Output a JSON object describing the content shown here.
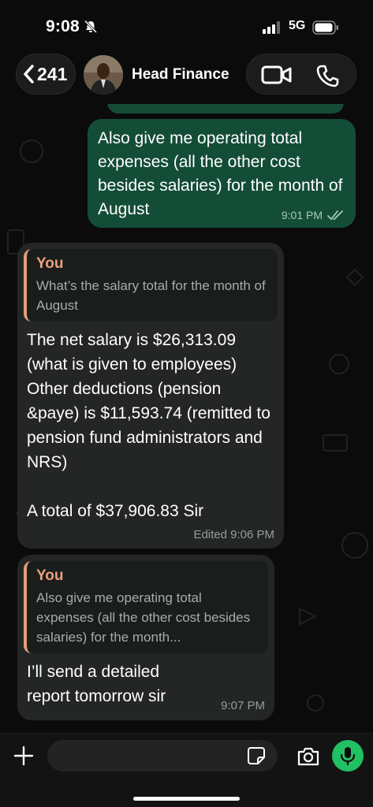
{
  "status_bar": {
    "time": "9:08",
    "network": "5G"
  },
  "header": {
    "back_count": "241",
    "contact_name": "Head Finance",
    "icons": [
      "chevron-left-icon",
      "video-call-icon",
      "phone-call-icon"
    ]
  },
  "messages": [
    {
      "direction": "sent",
      "text": "Also give me operating total expenses (all the other cost besides salaries) for the month of August",
      "time": "9:01 PM",
      "status": "read"
    },
    {
      "direction": "received",
      "quote_author": "You",
      "quote_text": "What’s the salary total for the month of August",
      "text": "The net salary is $26,313.09 (what is given to employees) Other deductions (pension &paye) is $11,593.74 (remitted to pension fund administrators and NRS)\n\nA total of $37,906.83 Sir",
      "time": "Edited 9:06 PM"
    },
    {
      "direction": "received",
      "quote_author": "You",
      "quote_text": "Also give me operating total expenses (all the other cost besides salaries) for the month...",
      "text": "I’ll send a detailed report tomorrow sir",
      "time": "9:07 PM"
    }
  ],
  "input_bar": {
    "value": "",
    "icons": [
      "plus-icon",
      "sticker-icon",
      "camera-icon",
      "microphone-icon"
    ]
  },
  "colors": {
    "sent_bubble": "#144d37",
    "received_bubble": "#242626",
    "quote_accent": "#e9a07c",
    "mic_green": "#21c063"
  }
}
